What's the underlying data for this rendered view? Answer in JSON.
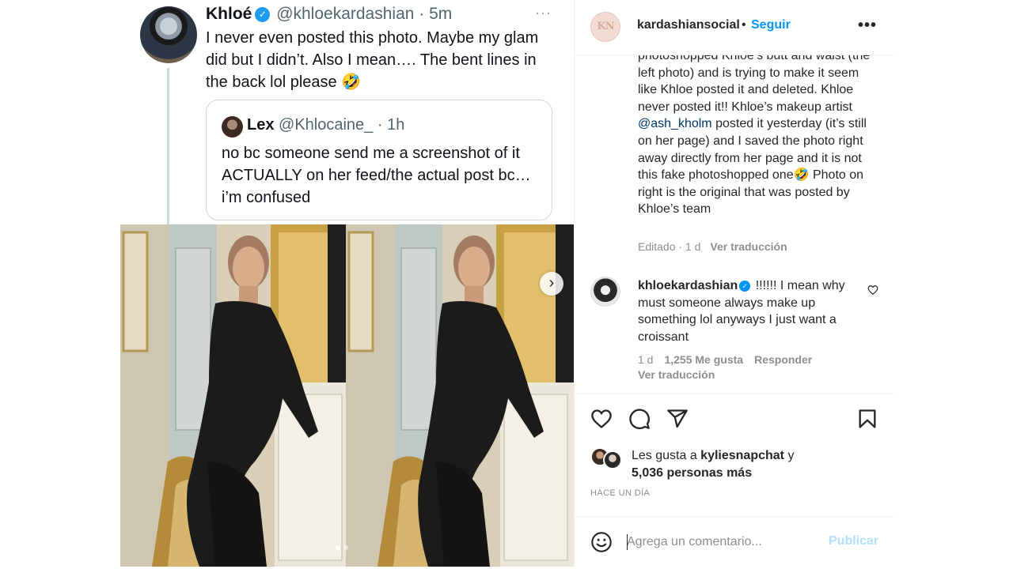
{
  "tweet": {
    "name": "Khloé",
    "handle": "@khloekardashian",
    "time": "· 5m",
    "more": "···",
    "text": "I never even posted this photo. Maybe my glam did but I didn’t. Also I mean…. The bent lines in the back lol please 🤣",
    "quote": {
      "name": "Lex",
      "handle": "@Khlocaine_",
      "time": "· 1h",
      "text": "no bc someone send me a screenshot of it ACTUALLY on her feed/the actual post bc… i’m confused"
    }
  },
  "media": {
    "next_arrow": "›",
    "slide_count": 2,
    "active_slide": 1
  },
  "panel": {
    "header": {
      "avatar_text": "KN",
      "account": "kardashiansocial",
      "separator": "•",
      "follow": "Seguir",
      "more": "•••"
    },
    "comment1": {
      "text_before": "photoshopped Khloe’s butt and waist (the left photo) and is trying to make it seem like Khloe posted it and deleted. Khloe never posted it!! Khloe’s makeup artist ",
      "mention": "@ash_kholm",
      "text_after": " posted it yesterday (it’s still on her page) and I saved the photo right away directly from her page and it is not this fake photoshopped one🤣 Photo on right is the original that was posted by Khloe’s team",
      "meta": "Editado · 1 d",
      "translate": "Ver traducción"
    },
    "comment2": {
      "user": "khloekardashian",
      "text": " !!!!!! I mean why must someone always make up something lol anyways I just want a croissant",
      "time": "1 d",
      "likes": "1,255 Me gusta",
      "reply": "Responder",
      "translate": "Ver traducción"
    },
    "likes": {
      "prefix": "Les gusta a ",
      "user": "kyliesnapchat",
      "connector": " y",
      "others": "5,036 personas más"
    },
    "time_ago": "HACE UN DÍA",
    "comment_box": {
      "placeholder": "Agrega un comentario...",
      "publish": "Publicar"
    }
  },
  "colors": {
    "instagram_blue": "#0095f6",
    "publish_disabled": "#b2dffc",
    "twitter_blue": "#1d9bf0",
    "muted_gray": "#8e8e8e"
  }
}
